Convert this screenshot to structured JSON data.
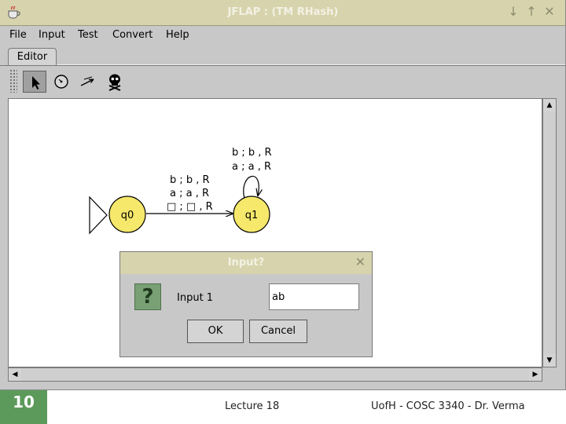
{
  "window": {
    "title": "JFLAP : (TM RHash)",
    "controls": {
      "minimize_icon": "↓",
      "maximize_icon": "↑",
      "close_icon": "✕"
    }
  },
  "menu": {
    "items": [
      {
        "label": "File"
      },
      {
        "label": "Input"
      },
      {
        "label": "Test"
      },
      {
        "label": "Convert"
      },
      {
        "label": "Help"
      }
    ]
  },
  "tabs": {
    "editor": "Editor"
  },
  "toolbar": {
    "tools": [
      {
        "name": "attribute-editor",
        "icon": "arrow-pointer-icon",
        "selected": true
      },
      {
        "name": "state-creator",
        "icon": "state-circle-icon",
        "selected": false
      },
      {
        "name": "transition-creator",
        "icon": "transition-arrow-icon",
        "selected": false
      },
      {
        "name": "deleter",
        "icon": "skull-icon",
        "selected": false
      }
    ]
  },
  "automaton": {
    "states": [
      {
        "id": "q0",
        "label": "q0",
        "initial": true
      },
      {
        "id": "q1",
        "label": "q1",
        "initial": false
      }
    ],
    "transitions": [
      {
        "from": "q0",
        "to": "q1",
        "labels": [
          "b ; b , R",
          "a ; a , R",
          "□ ; □ , R"
        ]
      },
      {
        "from": "q1",
        "to": "q1",
        "labels": [
          "b ; b , R",
          "a ; a , R"
        ]
      }
    ],
    "colors": {
      "state_fill": "#f5e86b",
      "state_stroke": "#000000"
    }
  },
  "dialog": {
    "title": "Input?",
    "close_icon": "✕",
    "icon": "?",
    "prompt": "Input 1",
    "input_value": "ab",
    "ok_label": "OK",
    "cancel_label": "Cancel"
  },
  "slide_footer": {
    "page_number": "10",
    "center": "Lecture 18",
    "right": "UofH - COSC 3340 - Dr. Verma"
  },
  "colors": {
    "titlebar": "#d7d4ad",
    "chrome": "#c8c8c8",
    "footer_accent": "#5c9a5b"
  }
}
